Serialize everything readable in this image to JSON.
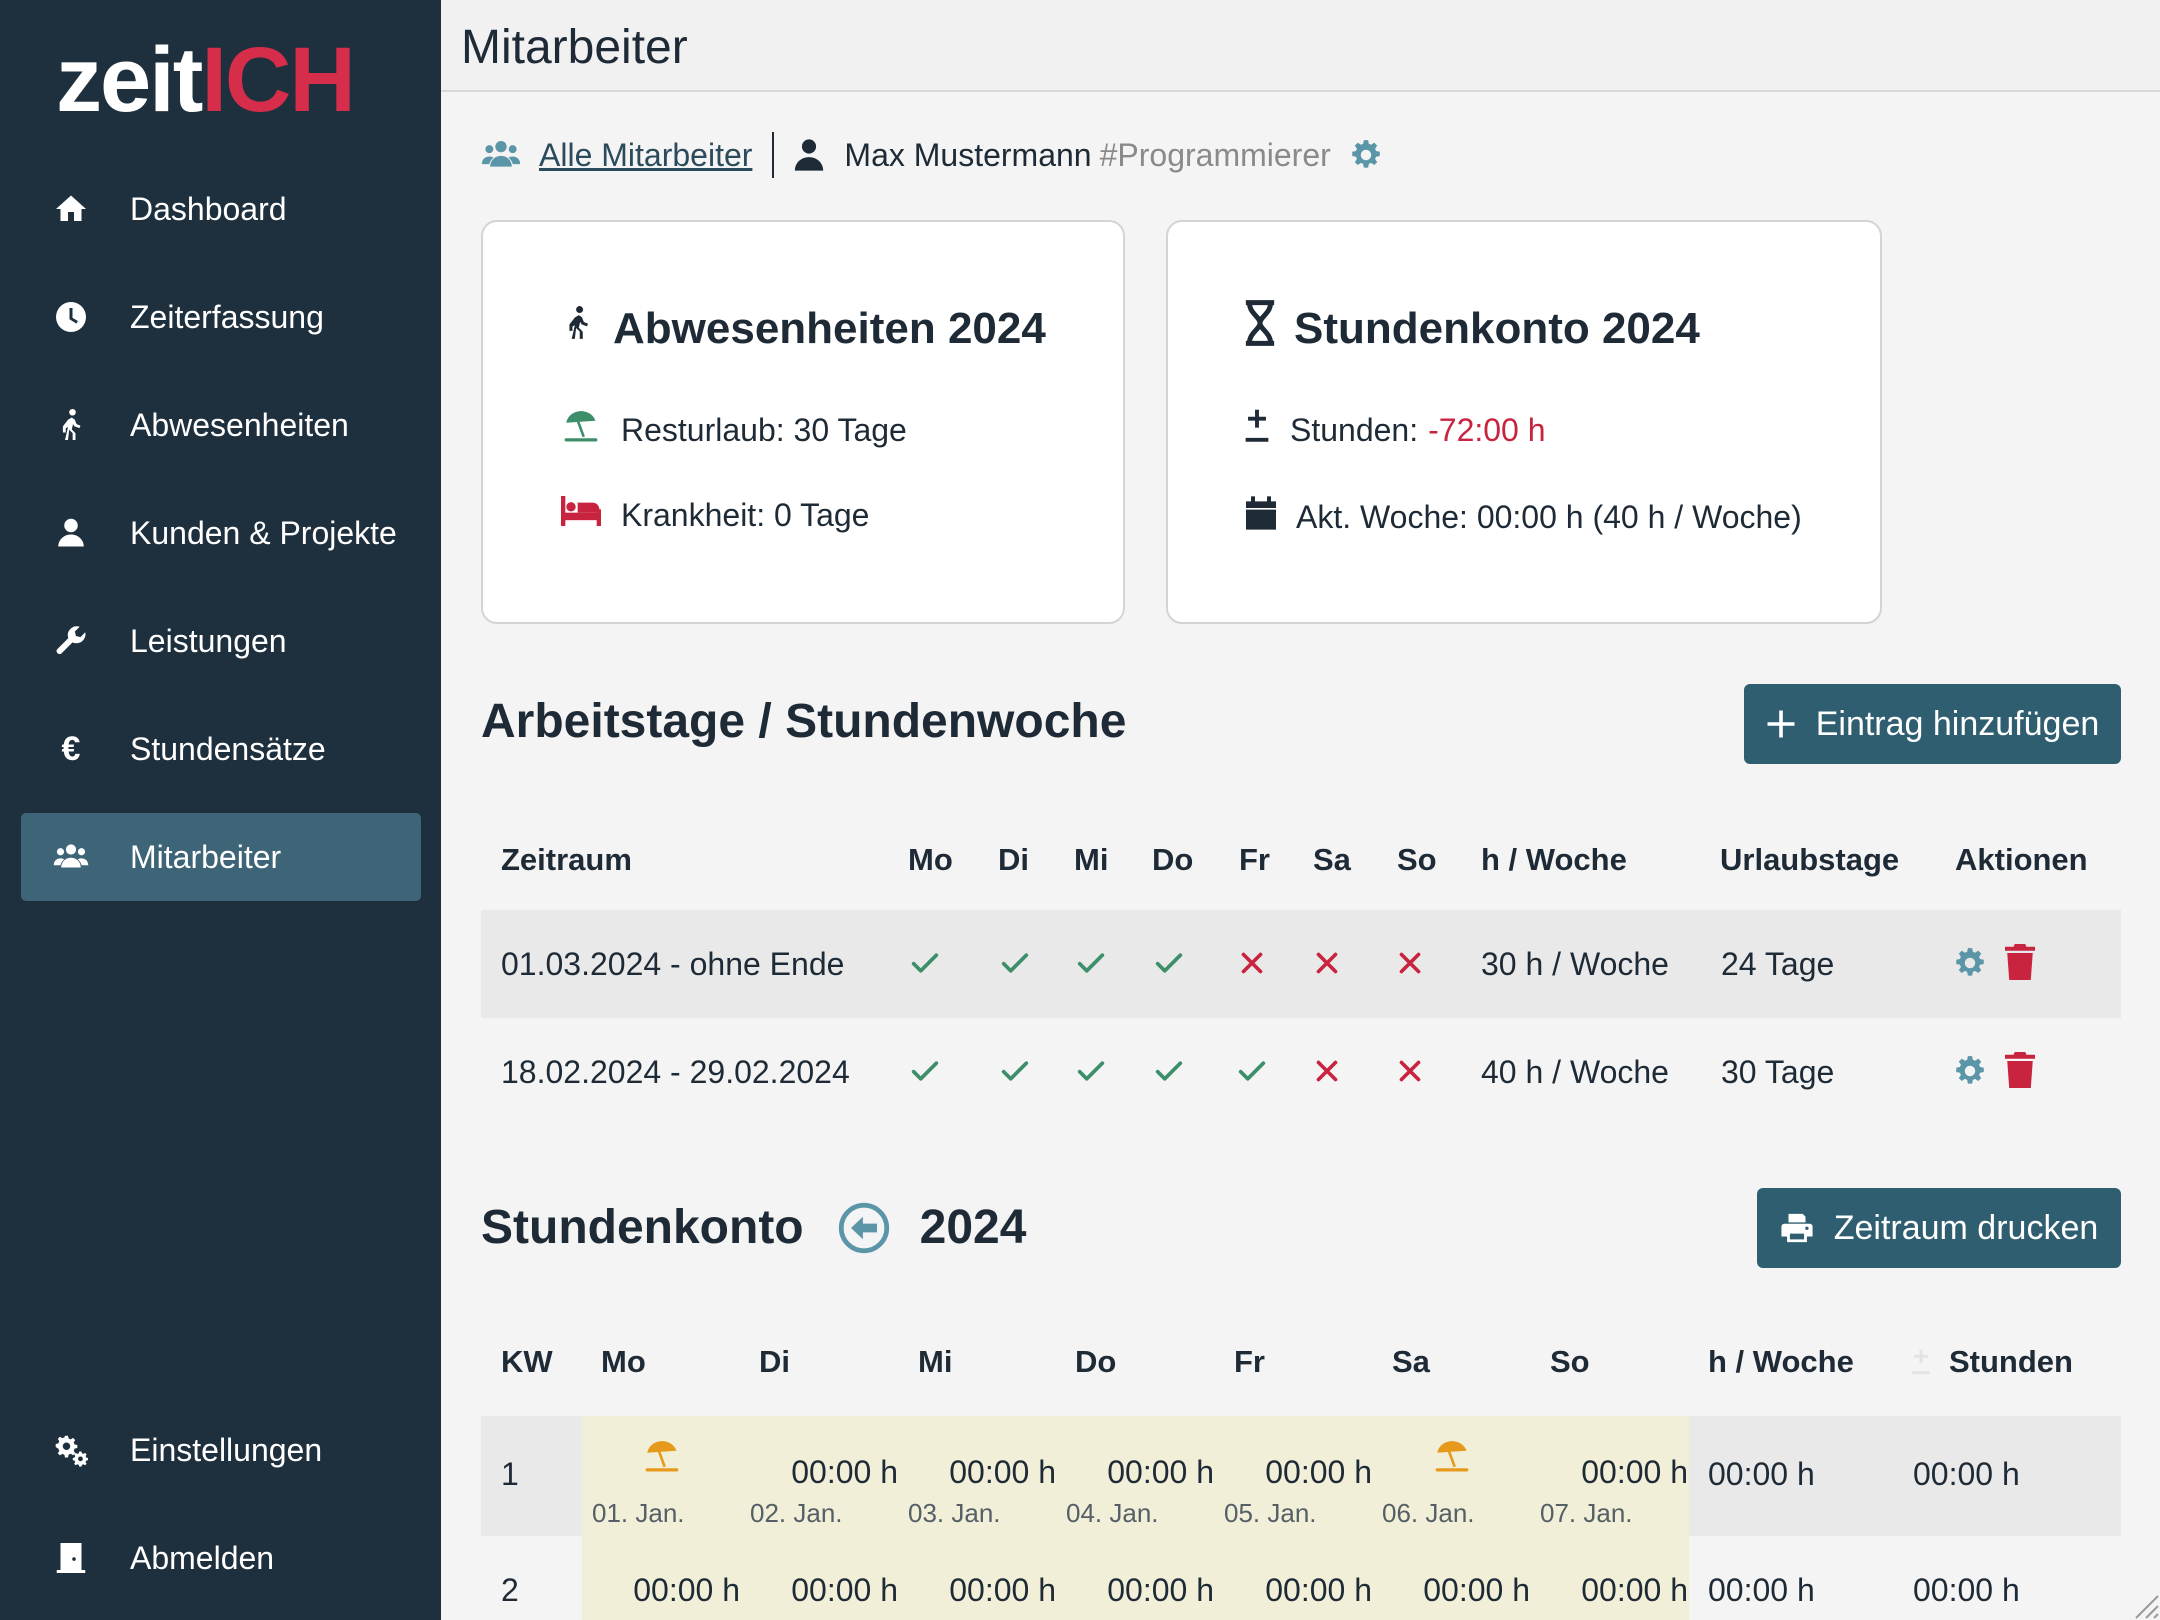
{
  "logo": {
    "white": "zeit",
    "red": "ICH"
  },
  "sidebar": {
    "items": [
      {
        "label": "Dashboard",
        "icon": "home-icon"
      },
      {
        "label": "Zeiterfassung",
        "icon": "clock-icon"
      },
      {
        "label": "Abwesenheiten",
        "icon": "walking-icon"
      },
      {
        "label": "Kunden & Projekte",
        "icon": "user-icon"
      },
      {
        "label": "Leistungen",
        "icon": "wrench-icon"
      },
      {
        "label": "Stundensätze",
        "icon": "euro-icon"
      },
      {
        "label": "Mitarbeiter",
        "icon": "users-icon",
        "active": true
      }
    ],
    "bottom": [
      {
        "label": "Einstellungen",
        "icon": "gears-icon"
      },
      {
        "label": "Abmelden",
        "icon": "door-icon"
      }
    ]
  },
  "header": {
    "title": "Mitarbeiter"
  },
  "breadcrumb": {
    "all": "Alle Mitarbeiter",
    "name": "Max Mustermann",
    "tag": "#Programmierer"
  },
  "absences_card": {
    "title": "Abwesenheiten 2024",
    "vacation": "Resturlaub: 30 Tage",
    "sickness": "Krankheit: 0 Tage"
  },
  "hours_card": {
    "title": "Stundenkonto 2024",
    "hours_label": "Stunden:",
    "hours_value": "-72:00 h",
    "week": "Akt. Woche: 00:00 h (40 h / Woche)"
  },
  "workdays": {
    "title": "Arbeitstage / Stundenwoche",
    "add_button": "Eintrag hinzufügen",
    "headers": {
      "zeitraum": "Zeitraum",
      "mo": "Mo",
      "di": "Di",
      "mi": "Mi",
      "do": "Do",
      "fr": "Fr",
      "sa": "Sa",
      "so": "So",
      "hw": "h / Woche",
      "urlaub": "Urlaubstage",
      "aktionen": "Aktionen"
    },
    "rows": [
      {
        "zeitraum": "01.03.2024 - ohne Ende",
        "days": [
          true,
          true,
          true,
          true,
          false,
          false,
          false
        ],
        "hw": "30 h / Woche",
        "urlaub": "24 Tage"
      },
      {
        "zeitraum": "18.02.2024 - 29.02.2024",
        "days": [
          true,
          true,
          true,
          true,
          true,
          false,
          false
        ],
        "hw": "40 h / Woche",
        "urlaub": "30 Tage"
      }
    ]
  },
  "account": {
    "title": "Stundenkonto",
    "year": "2024",
    "print_button": "Zeitraum drucken",
    "headers": {
      "kw": "KW",
      "mo": "Mo",
      "di": "Di",
      "mi": "Mi",
      "do": "Do",
      "fr": "Fr",
      "sa": "Sa",
      "so": "So",
      "hw": "h / Woche",
      "stunden": "Stunden"
    },
    "rows": [
      {
        "kw": "1",
        "cells": [
          {
            "value": "",
            "holiday": true,
            "date": "01. Jan."
          },
          {
            "value": "00:00 h",
            "date": "02. Jan."
          },
          {
            "value": "00:00 h",
            "date": "03. Jan."
          },
          {
            "value": "00:00 h",
            "date": "04. Jan."
          },
          {
            "value": "00:00 h",
            "date": "05. Jan."
          },
          {
            "value": "",
            "holiday": true,
            "date": "06. Jan."
          },
          {
            "value": "00:00 h",
            "date": "07. Jan."
          }
        ],
        "hw": "00:00 h",
        "stunden": "00:00 h"
      },
      {
        "kw": "2",
        "cells": [
          {
            "value": "00:00 h"
          },
          {
            "value": "00:00 h"
          },
          {
            "value": "00:00 h"
          },
          {
            "value": "00:00 h"
          },
          {
            "value": "00:00 h"
          },
          {
            "value": "00:00 h"
          },
          {
            "value": "00:00 h"
          }
        ],
        "hw": "00:00 h",
        "stunden": "00:00 h"
      }
    ]
  },
  "colors": {
    "sidebar": "#1e2f3d",
    "active": "#3e6577",
    "brand_red": "#d62d4a",
    "button": "#2f5e70",
    "check": "#3d8f6a",
    "cross": "#c8243f",
    "holiday": "#e69a1c",
    "weekhighlight": "#f2efd9"
  }
}
